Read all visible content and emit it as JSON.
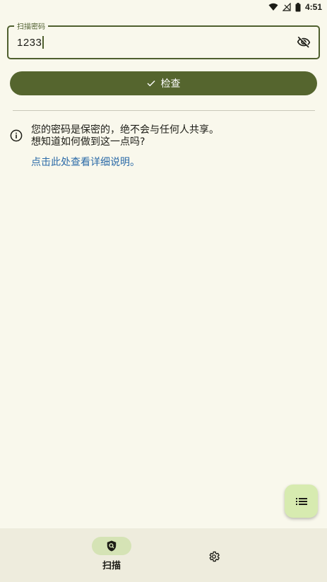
{
  "status_bar": {
    "time": "4:51"
  },
  "password_field": {
    "label": "扫描密码",
    "value": "1233"
  },
  "check_button": {
    "label": "检查"
  },
  "info": {
    "line1": "您的密码是保密的，绝不会与任何人共享。",
    "line2": "想知道如何做到这一点吗?",
    "link": "点击此处查看详细说明。"
  },
  "bottom_nav": {
    "scan_label": "扫描"
  },
  "colors": {
    "accent": "#55652e",
    "background": "#f9f8ec",
    "link": "#2c6ba8",
    "fab": "#d7ebb0"
  },
  "icons": [
    "wifi-icon",
    "signal-icon",
    "battery-icon",
    "visibility-off-icon",
    "check-icon",
    "info-icon",
    "list-icon",
    "shield-search-icon",
    "gear-icon"
  ]
}
